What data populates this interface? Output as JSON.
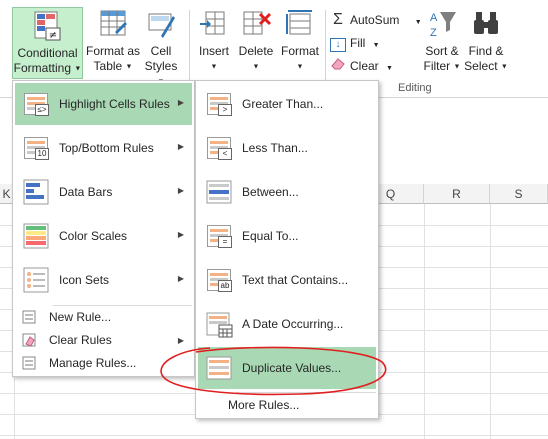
{
  "ribbon": {
    "conditional_formatting": {
      "line1": "Conditional",
      "line2": "Formatting"
    },
    "format_as_table": {
      "line1": "Format as",
      "line2": "Table"
    },
    "cell_styles": {
      "line1": "Cell",
      "line2": "Styles"
    },
    "insert": "Insert",
    "delete": "Delete",
    "format": "Format",
    "autosum": "AutoSum",
    "fill": "Fill",
    "clear": "Clear",
    "sort_filter": {
      "line1": "Sort &",
      "line2": "Filter"
    },
    "find_select": {
      "line1": "Find &",
      "line2": "Select"
    },
    "group_editing": "Editing",
    "icons": {
      "conditional_formatting": "conditional-formatting-icon",
      "format_as_table": "format-as-table-icon",
      "cell_styles": "cell-styles-icon",
      "insert": "insert-cells-icon",
      "delete": "delete-cells-icon",
      "format": "format-cells-icon",
      "autosum": "sigma-icon",
      "fill": "fill-down-icon",
      "clear": "eraser-icon",
      "sort_filter": "sort-filter-icon",
      "find_select": "binoculars-icon"
    }
  },
  "grid": {
    "columns": [
      "K",
      "Q",
      "R",
      "S"
    ]
  },
  "menu_main": {
    "items": [
      {
        "label": "Highlight Cells Rules",
        "has_submenu": true,
        "highlighted": true,
        "icon": "highlight-cells-icon"
      },
      {
        "label": "Top/Bottom Rules",
        "has_submenu": true,
        "highlighted": false,
        "icon": "top-bottom-icon"
      },
      {
        "label": "Data Bars",
        "has_submenu": true,
        "highlighted": false,
        "icon": "data-bars-icon"
      },
      {
        "label": "Color Scales",
        "has_submenu": true,
        "highlighted": false,
        "icon": "color-scales-icon"
      },
      {
        "label": "Icon Sets",
        "has_submenu": true,
        "highlighted": false,
        "icon": "icon-sets-icon"
      }
    ],
    "top_bottom_badge": "10",
    "small_items": [
      {
        "label": "New Rule...",
        "icon": "new-rule-icon",
        "has_submenu": false
      },
      {
        "label": "Clear Rules",
        "icon": "clear-rules-icon",
        "has_submenu": true
      },
      {
        "label": "Manage Rules...",
        "icon": "manage-rules-icon",
        "has_submenu": false
      }
    ]
  },
  "menu_sub": {
    "items": [
      {
        "label": "Greater Than...",
        "icon": "greater-than-icon",
        "badge": ">"
      },
      {
        "label": "Less Than...",
        "icon": "less-than-icon",
        "badge": "<"
      },
      {
        "label": "Between...",
        "icon": "between-icon",
        "badge": ""
      },
      {
        "label": "Equal To...",
        "icon": "equal-to-icon",
        "badge": "="
      },
      {
        "label": "Text that Contains...",
        "icon": "text-contains-icon",
        "badge": "ab"
      },
      {
        "label": "A Date Occurring...",
        "icon": "date-occurring-icon",
        "badge": ""
      },
      {
        "label": "Duplicate Values...",
        "icon": "duplicate-values-icon",
        "badge": "",
        "highlighted": true
      }
    ],
    "more_rules": "More Rules..."
  },
  "colors": {
    "highlight": "#a9d9b4",
    "ribbon_selected": "#c6efce",
    "annotation": "#e02020"
  }
}
